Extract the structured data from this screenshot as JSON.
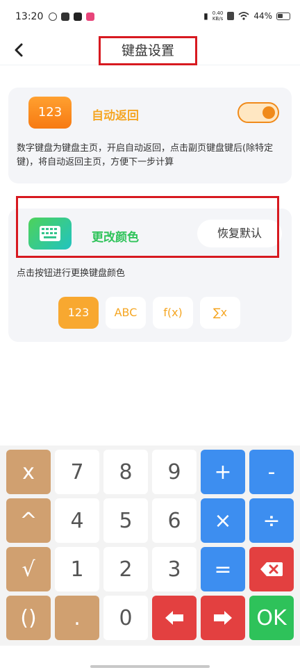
{
  "status_bar": {
    "time": "13:20",
    "speed_value": "0.40",
    "speed_unit": "KB/s",
    "battery": "44%"
  },
  "header": {
    "title": "键盘设置"
  },
  "auto_return": {
    "icon_text": "123",
    "label": "自动返回",
    "toggle_on": true,
    "description": "数字键盘为键盘主页，开启自动返回，点击副页键盘键后(除特定键)，将自动返回主页，方便下一步计算"
  },
  "color": {
    "label": "更改颜色",
    "reset_label": "恢复默认",
    "description": "点击按钮进行更换键盘颜色",
    "themes": [
      "123",
      "ABC",
      "f(x)",
      "∑x"
    ],
    "selected_theme": "123"
  },
  "keyboard": {
    "rows": [
      [
        "x",
        "7",
        "8",
        "9",
        "+",
        "-"
      ],
      [
        "^",
        "4",
        "5",
        "6",
        "×",
        "÷"
      ],
      [
        "√",
        "1",
        "2",
        "3",
        "=",
        "⌫"
      ],
      [
        "()",
        ".",
        "0",
        "←",
        "→",
        "OK"
      ]
    ]
  },
  "colors": {
    "accent_orange": "#f5a623",
    "accent_green": "#2fc35a",
    "key_tan": "#d0a070",
    "key_blue": "#3d8ef0",
    "key_red": "#e34040",
    "key_green": "#2ec25a",
    "annotation_red": "#d71920"
  }
}
